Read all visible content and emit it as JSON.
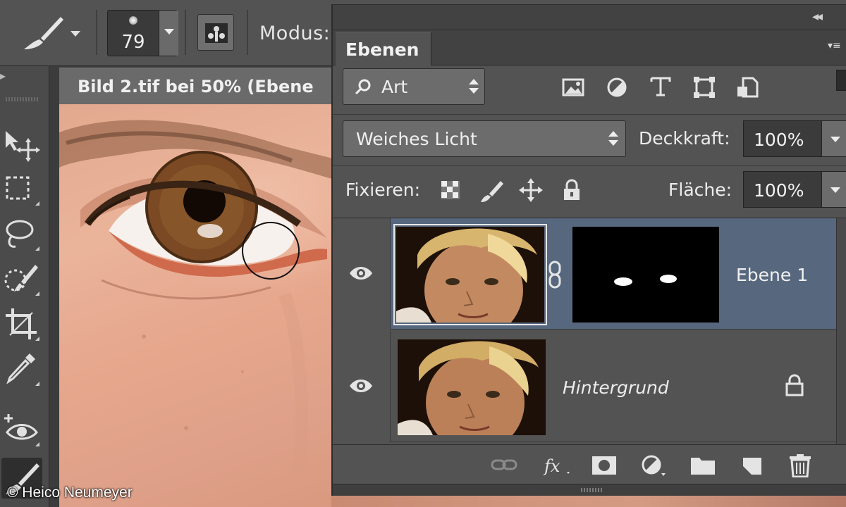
{
  "options_bar": {
    "brush_size": "79",
    "mode_label": "Modus:"
  },
  "document": {
    "tab_title": "Bild 2.tif bei 50% (Ebene"
  },
  "layers_panel": {
    "tab_label": "Ebenen",
    "filter_kind": "Art",
    "filter_icons": [
      "image-filter-icon",
      "adjustment-filter-icon",
      "type-filter-icon",
      "shape-filter-icon",
      "smart-object-filter-icon"
    ],
    "blend_mode": "Weiches Licht",
    "opacity_label": "Deckkraft:",
    "opacity_value": "100%",
    "lock_label": "Fixieren:",
    "lock_icons": [
      "lock-transparent-icon",
      "lock-image-icon",
      "lock-position-icon",
      "lock-all-icon"
    ],
    "fill_label": "Fläche:",
    "fill_value": "100%",
    "layers": [
      {
        "name": "Ebene 1",
        "visible": true,
        "selected": true,
        "has_mask": true
      },
      {
        "name": "Hintergrund",
        "visible": true,
        "selected": false,
        "locked": true
      }
    ],
    "bottom_icons": [
      "link-icon",
      "fx-icon",
      "add-mask-icon",
      "adjustment-layer-icon",
      "group-folder-icon",
      "new-layer-icon",
      "trash-icon"
    ]
  },
  "credit": "© Heico Neumeyer"
}
